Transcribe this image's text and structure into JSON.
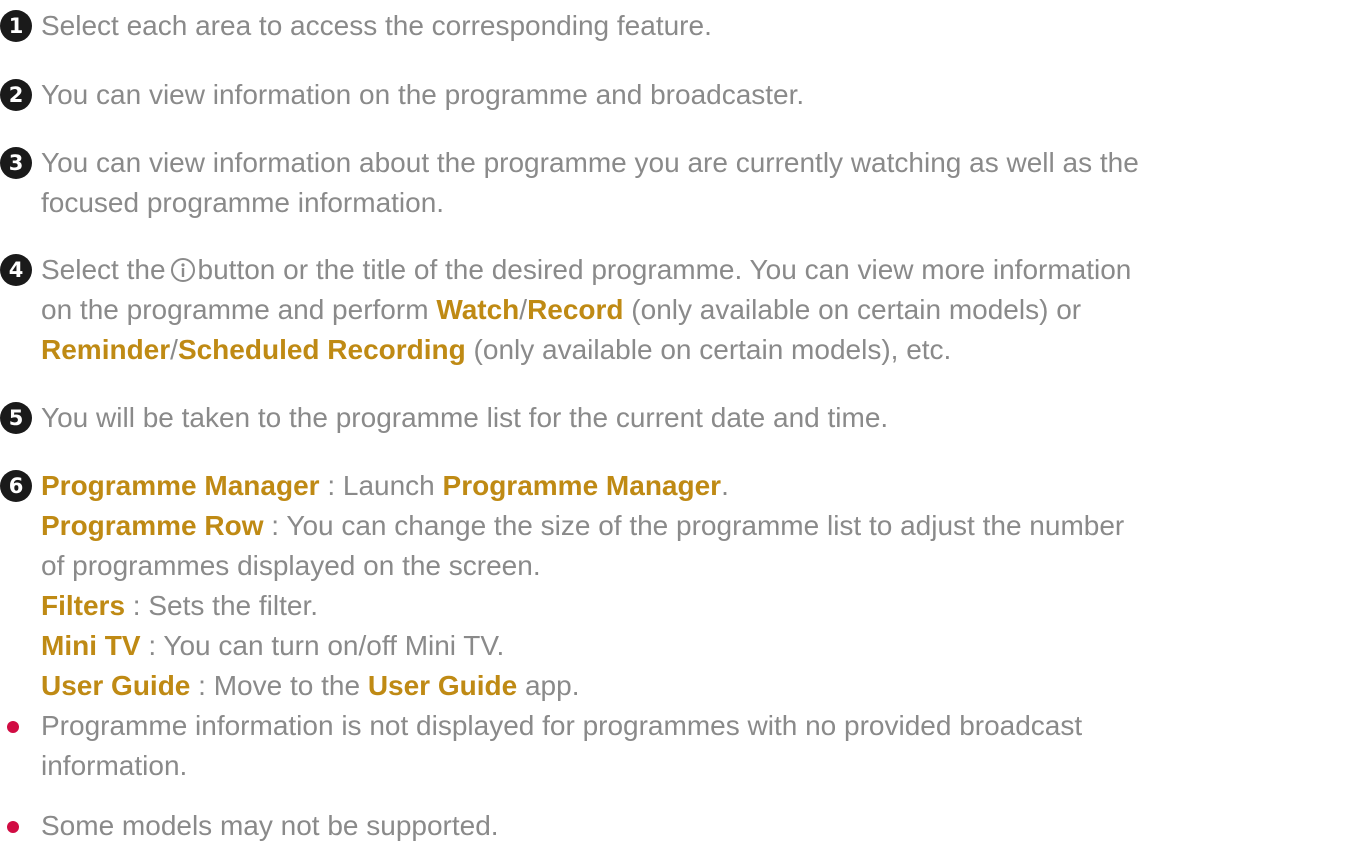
{
  "items": [
    {
      "number": "1",
      "text": "Select each area to access the corresponding feature."
    },
    {
      "number": "2",
      "text": "You can view information on the programme and broadcaster."
    },
    {
      "number": "3",
      "line1": "You can view information about the programme you are currently watching as well as the",
      "line2": "focused programme information."
    },
    {
      "number": "4",
      "line1_a": "Select the",
      "line1_b": "button or the title of the desired programme. You can view more information",
      "line2_a": "on the programme and perform ",
      "watch": "Watch",
      "slash1": "/",
      "record": "Record",
      "line2_b": " (only available on certain models) or",
      "reminder": "Reminder",
      "slash2": "/",
      "scheduled_recording": "Scheduled Recording",
      "line3_b": " (only available on certain models), etc."
    },
    {
      "number": "5",
      "text": "You will be taken to the programme list for the current date and time."
    },
    {
      "number": "6",
      "programme_manager": "Programme Manager",
      "pm_desc": " : Launch ",
      "programme_manager_2": "Programme Manager",
      "pm_end": ".",
      "programme_row": "Programme Row",
      "pr_desc1": " : You can change the size of the programme list to adjust the number",
      "pr_desc2": "of programmes displayed on the screen.",
      "filters": "Filters",
      "filters_desc": " : Sets the filter.",
      "mini_tv": "Mini TV",
      "mini_tv_desc": " : You can turn on/off Mini TV.",
      "user_guide": "User Guide",
      "ug_desc": " : Move to the ",
      "user_guide_2": "User Guide",
      "ug_end": " app."
    }
  ],
  "notes": [
    {
      "line1": "Programme information is not displayed for programmes with no provided broadcast",
      "line2": "information."
    },
    {
      "line1": "Some models may not be supported."
    }
  ],
  "icons": {
    "info_button": "info-circle-icon",
    "bullet": "bullet-dot-icon"
  },
  "colors": {
    "body_text": "#8a8a8a",
    "highlight": "#bf8a14",
    "bullet": "#d10c43",
    "number_circle": "#1a1a1a"
  }
}
